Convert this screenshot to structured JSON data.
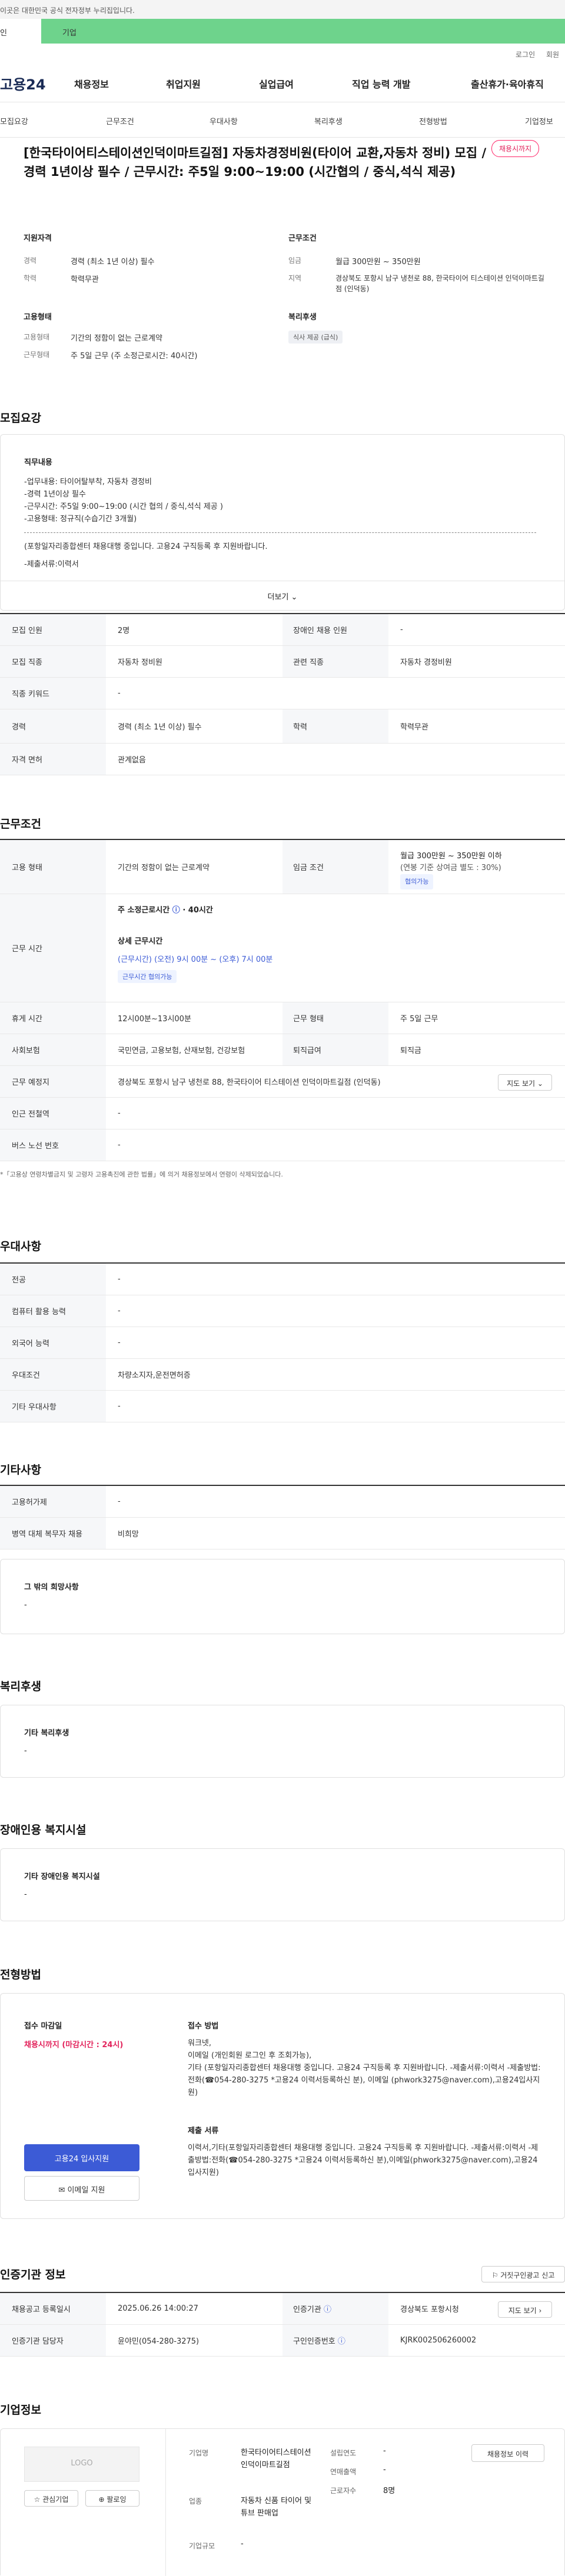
{
  "gov_banner": "이곳은 대한민국 공식 전자정부 누리집입니다.",
  "tabs": [
    "인",
    "기업"
  ],
  "util": [
    "로그인",
    "회원"
  ],
  "gnb": {
    "logo": "고용24",
    "menu": [
      "채용정보",
      "취업지원",
      "실업급여",
      "직업 능력 개발",
      "출산휴가·육아휴직"
    ]
  },
  "anchor": [
    "모집요강",
    "근무조건",
    "우대사항",
    "복리후생",
    "전형방법",
    "기업정보"
  ],
  "header": {
    "title": "[한국타이어티스테이션인덕이마트길점] 자동차경정비원(타이어 교환,자동차 정비) 모집 / 경력 1년이상 필수 / 근무시간: 주5일 9:00~19:00 (시간협의 / 중식,석식 제공)",
    "badge": "채용시까지",
    "qual_h": "지원자격",
    "exp_k": "경력",
    "exp_v": "경력 (최소 1년 이상) 필수",
    "edu_k": "학력",
    "edu_v": "학력무관",
    "cond_h": "근무조건",
    "pay_k": "임금",
    "pay_v": "월급 300만원 ~ 350만원",
    "loc_k": "지역",
    "loc_v": "경상북도 포항시 남구 냉천로 88, 한국타이어 티스테이션 인덕이마트길점 (인덕동)",
    "emp_h": "고용형태",
    "emptype_k": "고용형태",
    "emptype_v": "기간의 정함이 없는 근로계약",
    "worktype_k": "근무형태",
    "worktype_v": "주 5일 근무 (주 소정근로시간: 40시간)",
    "welfare_h": "복리후생",
    "welfare_chip": "식사 제공 (급식)"
  },
  "recruit": {
    "heading": "모집요강",
    "job_h": "직무내용",
    "job_text": "-업무내용: 타이어탈부착, 자동차 경정비\n-경력 1년이상 필수\n-근무시간: 주5일 9:00~19:00 (시간 협의 / 중식,석식 제공 )\n-고용형태: 정규직(수습기간 3개월)",
    "job_text2": "(포항일자리종합센터 채용대행 중입니다. 고용24 구직등록 후 지원바랍니다.",
    "job_text3": "-제출서류:이력서",
    "more": "더보기",
    "r1": [
      "모집 인원",
      "2명",
      "장애인 채용 인원",
      "-"
    ],
    "r2": [
      "모집 직종",
      "자동차 정비원",
      "관련 직종",
      "자동차 경정비원"
    ],
    "r3": [
      "직종 키워드",
      "-"
    ],
    "r4": [
      "경력",
      "경력 (최소 1년 이상) 필수",
      "학력",
      "학력무관"
    ],
    "r5": [
      "자격 면허",
      "관계없음"
    ]
  },
  "cond": {
    "heading": "근무조건",
    "emp_k": "고용 형태",
    "emp_v": "기간의 정함이 없는 근로계약",
    "pay_k": "임금 조건",
    "pay_v1": "월급 300만원 ~ 350만원 이하",
    "pay_v2": "(연봉 기준 상여금 별도 : 30%)",
    "pay_chip": "협의가능",
    "time_k": "근무 시간",
    "time_v1": "주 소정근로시간",
    "time_v1b": "40시간",
    "time_v2": "상세 근무시간",
    "time_v3": "(근무시간) (오전) 9시 00분 ~ (오후) 7시 00분",
    "time_chip": "근무시간 협의가능",
    "rest_k": "휴게 시간",
    "rest_v": "12시00분~13시00분",
    "wt_k": "근무 형태",
    "wt_v": "주 5일 근무",
    "ins_k": "사회보험",
    "ins_v": "국민연금, 고용보험, 산재보험, 건강보험",
    "ret_k": "퇴직급여",
    "ret_v": "퇴직금",
    "place_k": "근무 예정지",
    "place_v": "경상북도 포항시 남구 냉천로 88, 한국타이어 티스테이션 인덕이마트길점 (인덕동)",
    "map_btn": "지도 보기",
    "subway_k": "인근 전철역",
    "subway_v": "-",
    "bus_k": "버스 노선 번호",
    "bus_v": "-",
    "note": "*「고용상 연령차별금지 및 고령자 고용촉진에 관한 법률」에 의거 채용정보에서 연령이 삭제되었습니다."
  },
  "pref": {
    "heading": "우대사항",
    "rows": [
      [
        "전공",
        "-"
      ],
      [
        "컴퓨터 활용 능력",
        "-"
      ],
      [
        "외국어 능력",
        "-"
      ],
      [
        "우대조건",
        "차량소지자,운전면허증"
      ],
      [
        "기타 우대사항",
        "-"
      ]
    ]
  },
  "etc": {
    "heading": "기타사항",
    "rows": [
      [
        "고용허가제",
        "-"
      ],
      [
        "병역 대체 복무자 채용",
        "비희망"
      ]
    ],
    "hope_h": "그 밖의 희망사항",
    "hope_v": "-"
  },
  "welfare": {
    "heading": "복리후생",
    "sub": "기타 복리후생",
    "v": "-"
  },
  "disab": {
    "heading": "장애인용 복지시설",
    "sub": "기타 장애인용 복지시설",
    "v": "-"
  },
  "screen": {
    "heading": "전형방법",
    "deadline_h": "접수 마감일",
    "deadline_v": "채용시까지 (마감시간 : 24시)",
    "method_h": "접수 방법",
    "method_v": "워크넷,\n이메일 (개인회원 로그인 후 조회가능),\n기타 (포항일자리종합센터 채용대행 중입니다. 고용24 구직등록 후 지원바랍니다. -제출서류:이력서 -제출방법:전화(☎054-280-3275 *고용24 이력서등록하신 분), 이메일 (phwork3275@naver.com),고용24입사지원)",
    "docs_h": "제출 서류",
    "docs_v": "이력서,기타(포항일자리종합센터 채용대행 중입니다. 고용24 구직등록 후 지원바랍니다. -제출서류:이력서 -제출방법:전화(☎054-280-3275 *고용24 이력서등록하신 분),이메일(phwork3275@naver.com),고용24입사지원)",
    "apply_btn": "고용24 입사지원",
    "mail_btn": "이메일 지원"
  },
  "cert": {
    "heading": "인증기관 정보",
    "report_btn": "거짓구인광고 신고",
    "r1": [
      "채용공고 등록일시",
      "2025.06.26 14:00:27",
      "인증기관",
      "경상북도 포항시청"
    ],
    "map_btn": "지도 보기",
    "r2": [
      "인증기관 담당자",
      "윤야민(054-280-3275)",
      "구인인증번호",
      "KJRK002506260002"
    ]
  },
  "company": {
    "heading": "기업정보",
    "logo": "LOGO",
    "fav_btn": "관심기업",
    "follow_btn": "팔로잉",
    "type_k": "기업명",
    "type_v": "한국타이어티스테이션인덕이마트길점",
    "ind_k": "업종",
    "ind_v": "자동차 신품 타이어 및 튜브 판매업",
    "scale_k": "기업규모",
    "scale_v": "-",
    "year_k": "설립연도",
    "year_v": "-",
    "sales_k": "연매출액",
    "sales_v": "-",
    "staff_k": "근로자수",
    "staff_v": "8명",
    "info_btn": "채용정보 이력"
  },
  "colors": {
    "accent": "#e2245c",
    "green": "#6ed38c",
    "blue": "#3c5bd6",
    "link": "#2255bb"
  }
}
